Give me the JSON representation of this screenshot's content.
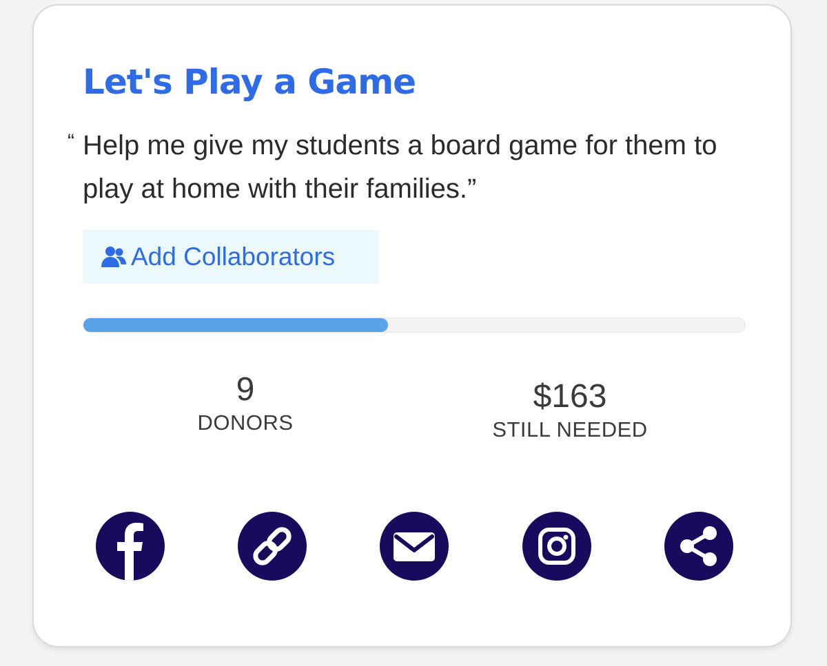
{
  "project": {
    "title": "Let's Play a Game",
    "quote_open": "“",
    "quote": "Help me give my students a board game for them to play at home with their families.”"
  },
  "collaborators": {
    "label": "Add Collaborators",
    "icon": "users-icon"
  },
  "progress": {
    "fraction": 0.46
  },
  "stats": {
    "donors_value": "9",
    "donors_label": "DONORS",
    "needed_value": "$163",
    "needed_label": "STILL NEEDED"
  },
  "share": {
    "icons": [
      "facebook-icon",
      "link-icon",
      "email-icon",
      "instagram-icon",
      "share-icon"
    ]
  },
  "colors": {
    "accent": "#2e6be6",
    "progress_fill": "#5ba3e8",
    "progress_track": "#f2f2f2",
    "share_bg": "#170b5e",
    "collab_bg": "#ecf9fc",
    "text": "#2b2b2b"
  }
}
